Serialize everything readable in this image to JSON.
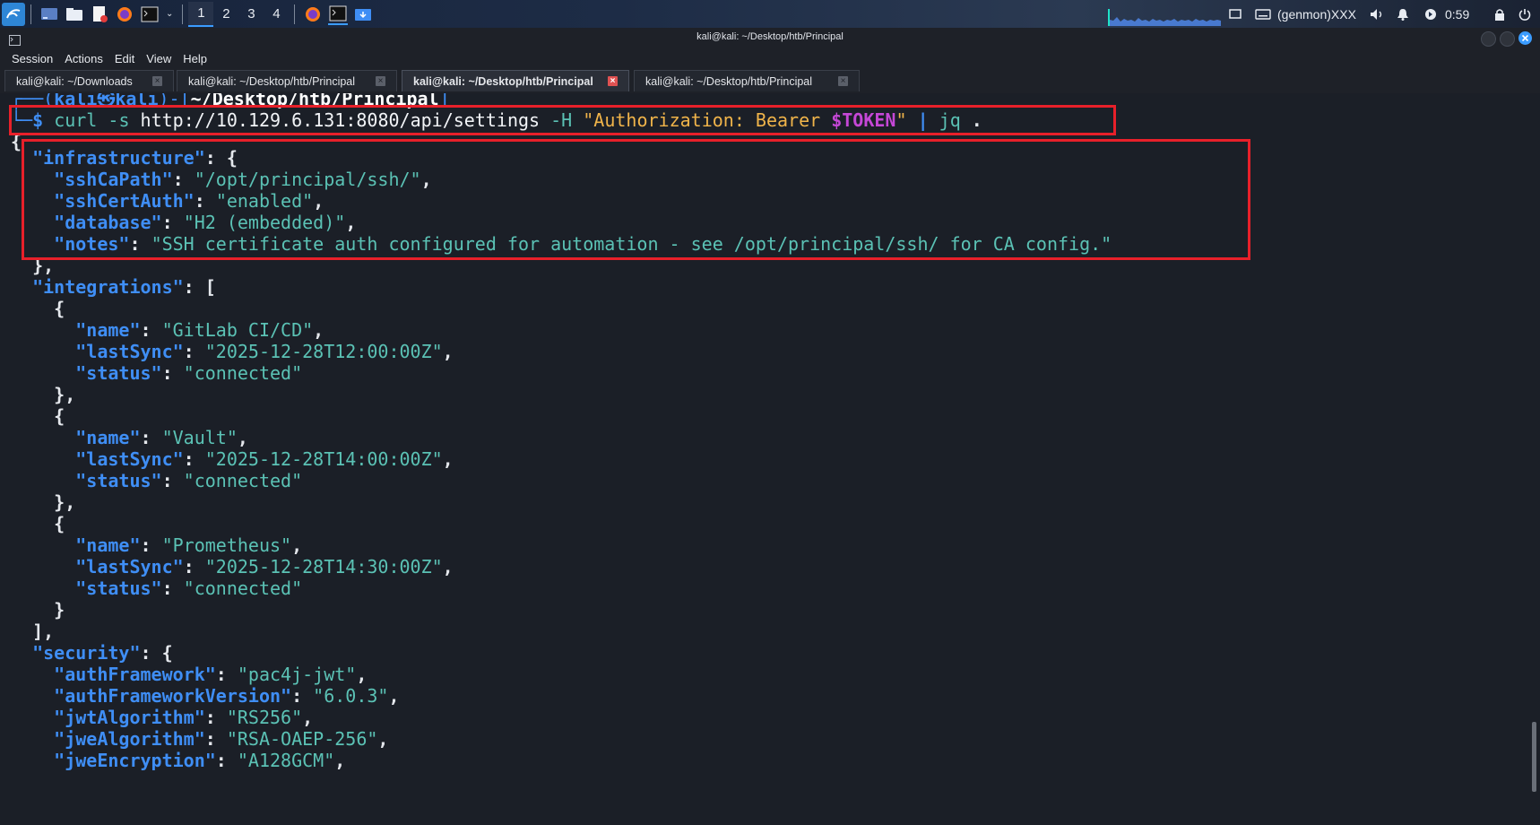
{
  "panel": {
    "workspaces": [
      "1",
      "2",
      "3",
      "4"
    ],
    "active_workspace": "1",
    "genmon": "(genmon)XXX",
    "clock": "0:59",
    "launchers": [
      "terminal-icon",
      "files-icon",
      "editor-icon",
      "firefox-icon",
      "terminal-icon"
    ],
    "accent": "#3b9cff"
  },
  "window": {
    "title": "kali@kali: ~/Desktop/htb/Principal"
  },
  "menubar": {
    "items": [
      "Session",
      "Actions",
      "Edit",
      "View",
      "Help"
    ]
  },
  "tabs": [
    {
      "label": "kali@kali: ~/Downloads",
      "active": false
    },
    {
      "label": "kali@kali: ~/Desktop/htb/Principal",
      "active": false
    },
    {
      "label": "kali@kali: ~/Desktop/htb/Principal",
      "active": true
    },
    {
      "label": "kali@kali: ~/Desktop/htb/Principal",
      "active": false
    }
  ],
  "terminal": {
    "prompt": {
      "user": "kali",
      "skull": "㉿",
      "host": "kali",
      "cwd": "~/Desktop/htb/Principal",
      "symbol": "$"
    },
    "command": {
      "program": "curl",
      "flag1": "-s",
      "url": "http://10.129.6.131:8080/api/settings",
      "flag2": "-H",
      "header_open": "\"Authorization: Bearer ",
      "header_var": "$TOKEN",
      "header_close": "\"",
      "pipe": "|",
      "filter_cmd": "jq",
      "filter_arg": "."
    },
    "output": {
      "infrastructure": {
        "sshCaPath": "\"/opt/principal/ssh/\"",
        "sshCertAuth": "\"enabled\"",
        "database": "\"H2 (embedded)\"",
        "notes": "\"SSH certificate auth configured for automation - see /opt/principal/ssh/ for CA config.\""
      },
      "integrations": [
        {
          "name": "\"GitLab CI/CD\"",
          "lastSync": "\"2025-12-28T12:00:00Z\"",
          "status": "\"connected\""
        },
        {
          "name": "\"Vault\"",
          "lastSync": "\"2025-12-28T14:00:00Z\"",
          "status": "\"connected\""
        },
        {
          "name": "\"Prometheus\"",
          "lastSync": "\"2025-12-28T14:30:00Z\"",
          "status": "\"connected\""
        }
      ],
      "security": {
        "authFramework": "\"pac4j-jwt\"",
        "authFrameworkVersion": "\"6.0.3\"",
        "jwtAlgorithm": "\"RS256\"",
        "jweAlgorithm": "\"RSA-OAEP-256\"",
        "jweEncryption": "\"A128GCM\""
      }
    },
    "colors": {
      "key": "#3f8ef5",
      "string": "#5bc2b5",
      "highlight": "#e8202a"
    }
  }
}
